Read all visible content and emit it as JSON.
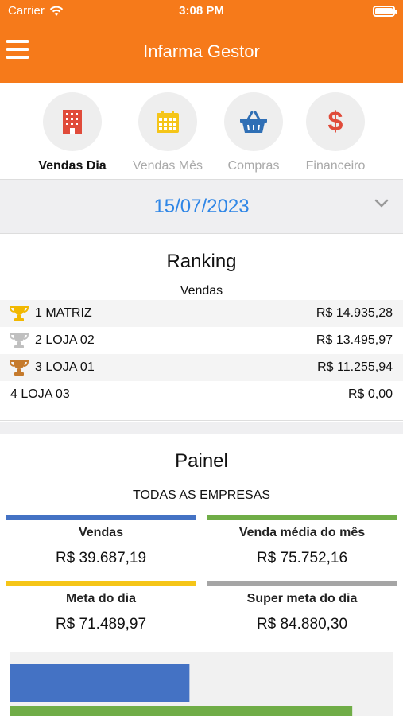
{
  "status_bar": {
    "carrier": "Carrier",
    "time": "3:08 PM"
  },
  "header": {
    "title": "Infarma Gestor"
  },
  "tabs": [
    {
      "label": "Vendas Dia",
      "icon": "building-icon",
      "active": true
    },
    {
      "label": "Vendas Mês",
      "icon": "calendar-icon",
      "active": false
    },
    {
      "label": "Compras",
      "icon": "basket-icon",
      "active": false
    },
    {
      "label": "Financeiro",
      "icon": "dollar-icon",
      "active": false
    }
  ],
  "date_selector": {
    "value": "15/07/2023"
  },
  "ranking": {
    "title": "Ranking",
    "subtitle": "Vendas",
    "rows": [
      {
        "name": "1 MATRIZ",
        "value": "R$ 14.935,28",
        "trophy": "gold"
      },
      {
        "name": "2 LOJA 02",
        "value": "R$ 13.495,97",
        "trophy": "silver"
      },
      {
        "name": "3 LOJA 01",
        "value": "R$ 11.255,94",
        "trophy": "bronze"
      },
      {
        "name": "4 LOJA 03",
        "value": "R$ 0,00",
        "trophy": "none"
      }
    ]
  },
  "painel": {
    "title": "Painel",
    "subtitle": "TODAS AS EMPRESAS",
    "cards": [
      {
        "title": "Vendas",
        "value": "R$ 39.687,19",
        "color": "#4472c4"
      },
      {
        "title": "Venda média do mês",
        "value": "R$ 75.752,16",
        "color": "#70ad47"
      },
      {
        "title": "Meta do dia",
        "value": "R$ 71.489,97",
        "color": "#f5c518"
      },
      {
        "title": "Super meta do dia",
        "value": "R$ 84.880,30",
        "color": "#a5a5a5"
      }
    ]
  },
  "chart_data": {
    "type": "bar",
    "orientation": "horizontal",
    "categories": [
      "Vendas",
      "Venda média do mês"
    ],
    "values": [
      39687.19,
      75752.16
    ],
    "colors": [
      "#4472c4",
      "#70ad47"
    ],
    "xlim": [
      0,
      84880.3
    ]
  },
  "colors": {
    "brand": "#f67a1a",
    "date_text": "#2f86e6",
    "gold": "#f2b800",
    "silver": "#c0c0c0",
    "bronze": "#c57a2c"
  }
}
